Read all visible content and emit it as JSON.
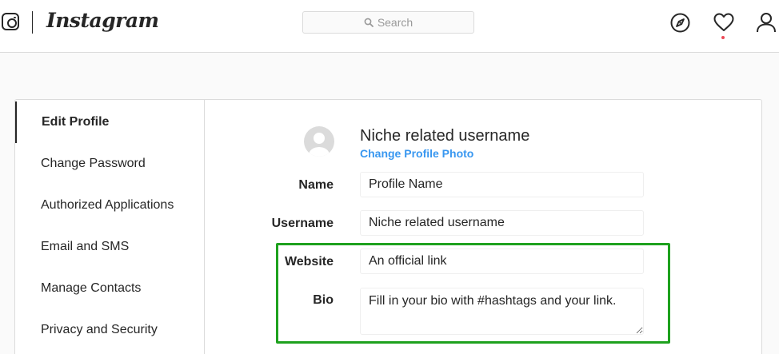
{
  "header": {
    "brand_name": "Instagram",
    "search": {
      "placeholder": "Search"
    },
    "icons": [
      "instagram-glyph-icon",
      "search-icon",
      "compass-icon",
      "heart-icon",
      "person-icon"
    ],
    "notification_dot_color": "#ed4956"
  },
  "sidebar": {
    "items": [
      {
        "label": "Edit Profile",
        "active": true
      },
      {
        "label": "Change Password"
      },
      {
        "label": "Authorized Applications"
      },
      {
        "label": "Email and SMS"
      },
      {
        "label": "Manage Contacts"
      },
      {
        "label": "Privacy and Security"
      }
    ]
  },
  "profile": {
    "username": "Niche related username",
    "change_photo_label": "Change Profile Photo",
    "avatar_icon": "avatar-placeholder-icon"
  },
  "form": {
    "name": {
      "label": "Name",
      "value": "Profile Name"
    },
    "username": {
      "label": "Username",
      "value": "Niche related username"
    },
    "website": {
      "label": "Website",
      "value": "An official link"
    },
    "bio": {
      "label": "Bio",
      "value": "Fill in your bio with #hashtags and your link."
    }
  },
  "colors": {
    "link": "#3897f0",
    "highlight": "#1ea11e",
    "border": "#dbdbdb",
    "text": "#262626"
  }
}
